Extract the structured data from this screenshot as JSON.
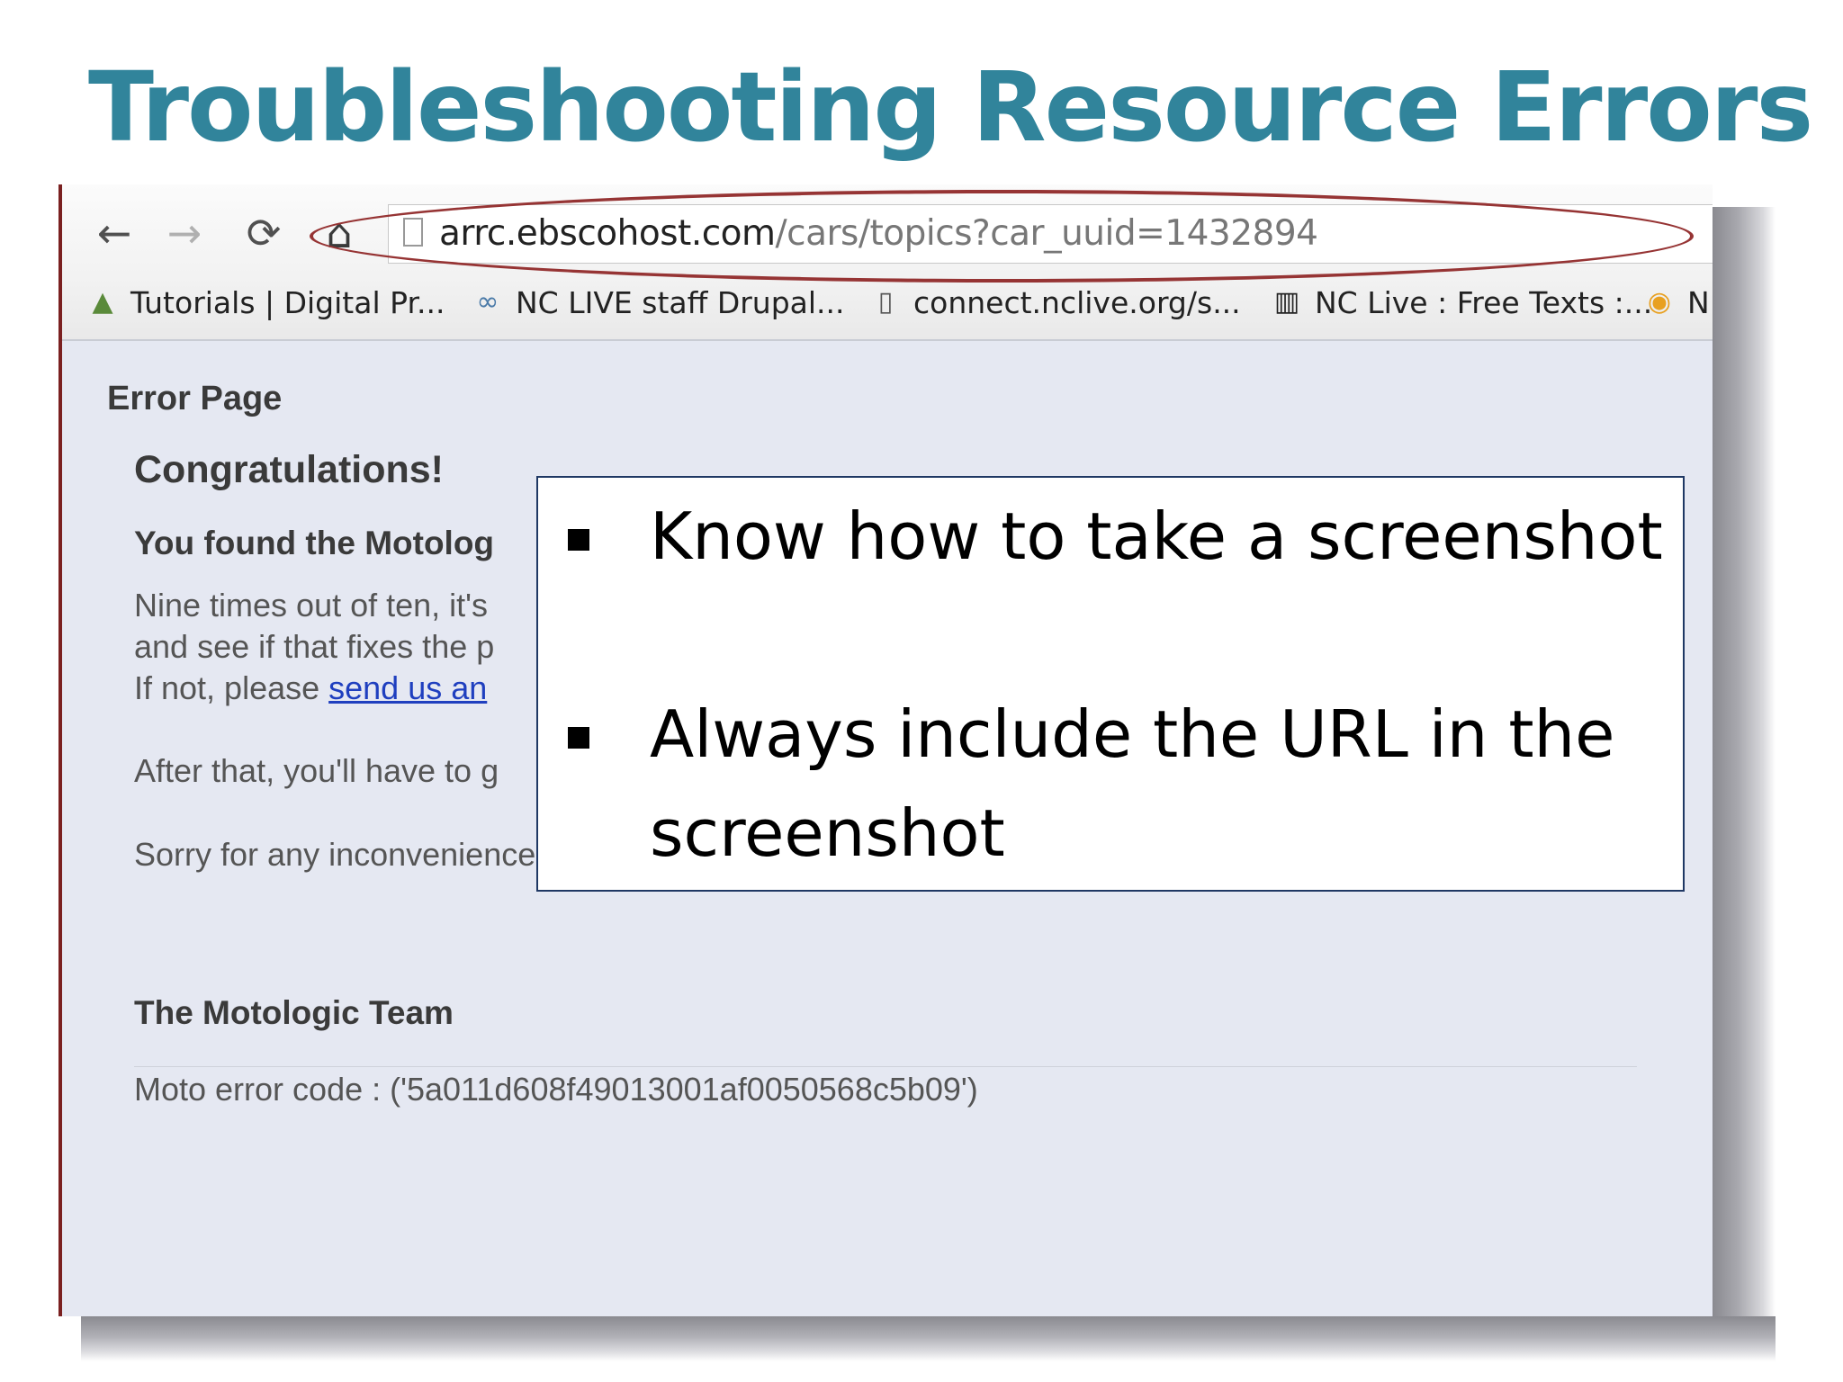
{
  "slide": {
    "title": "Troubleshooting Resource Errors"
  },
  "browser": {
    "url_host": "arrc.ebscohost.com",
    "url_path": "/cars/topics?car_uuid=1432894",
    "bookmarks": [
      {
        "label": "Tutorials | Digital Pr...",
        "icon": "tutorial-icon"
      },
      {
        "label": "NC LIVE staff Drupal...",
        "icon": "drupal-icon"
      },
      {
        "label": "connect.nclive.org/s...",
        "icon": "page-icon"
      },
      {
        "label": "NC Live : Free Texts :...",
        "icon": "library-icon"
      },
      {
        "label": "N",
        "icon": "orange-circle-icon"
      }
    ]
  },
  "error_page": {
    "heading": "Error Page",
    "congrats": "Congratulations!",
    "found": "You found the Motolog",
    "para1_line1": "Nine times out of ten, it's",
    "para1_line2": "and see if that fixes the p",
    "para2_prefix": "If not, please ",
    "para2_link": "send us an",
    "para3": "After that, you'll have to g",
    "para4": "Sorry for any inconvenience,",
    "team": "The Motologic Team",
    "error_code": "Moto error code : ('5a011d608f49013001af0050568c5b09')"
  },
  "callout": {
    "bullets": [
      "Know how to take a screenshot",
      "Always include the URL in the screenshot"
    ]
  }
}
